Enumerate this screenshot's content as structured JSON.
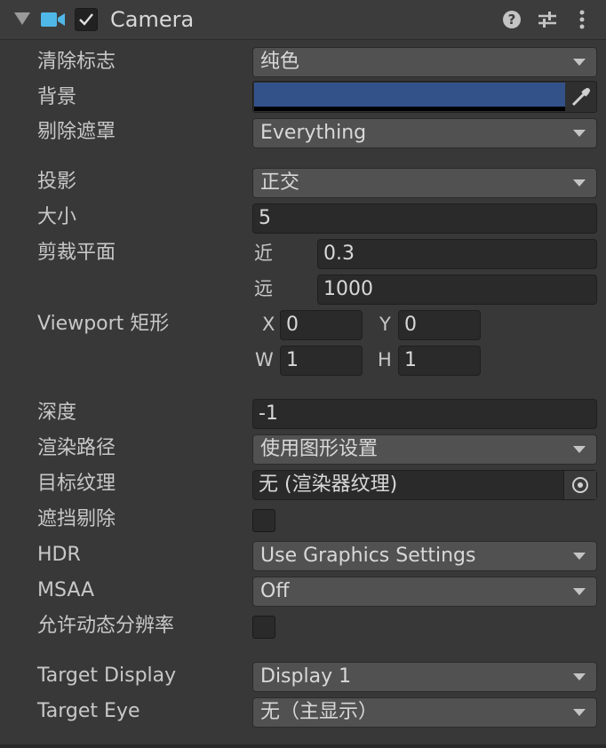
{
  "header": {
    "title": "Camera",
    "icons": [
      "foldout-arrow-icon",
      "camera-icon",
      "checkmark-icon",
      "help-icon",
      "preset-sliders-icon",
      "more-vertical-icon"
    ]
  },
  "fields": {
    "clear_flags": {
      "label": "清除标志",
      "value": "纯色"
    },
    "background": {
      "label": "背景",
      "color": "#34528a"
    },
    "culling_mask": {
      "label": "剔除遮罩",
      "value": "Everything"
    },
    "projection": {
      "label": "投影",
      "value": "正交"
    },
    "size": {
      "label": "大小",
      "value": "5"
    },
    "clipping": {
      "label": "剪裁平面",
      "near_label": "近",
      "near": "0.3",
      "far_label": "远",
      "far": "1000"
    },
    "viewport": {
      "label": "Viewport 矩形",
      "x_label": "X",
      "x": "0",
      "y_label": "Y",
      "y": "0",
      "w_label": "W",
      "w": "1",
      "h_label": "H",
      "h": "1"
    },
    "depth": {
      "label": "深度",
      "value": "-1"
    },
    "rendering_path": {
      "label": "渲染路径",
      "value": "使用图形设置"
    },
    "target_texture": {
      "label": "目标纹理",
      "value": "无 (渲染器纹理)"
    },
    "occlusion_culling": {
      "label": "遮挡剔除",
      "checked": false
    },
    "hdr": {
      "label": "HDR",
      "value": "Use Graphics Settings"
    },
    "msaa": {
      "label": "MSAA",
      "value": "Off"
    },
    "dynamic_resolution": {
      "label": "允许动态分辨率",
      "checked": false
    },
    "target_display": {
      "label": "Target Display",
      "value": "Display 1"
    },
    "target_eye": {
      "label": "Target Eye",
      "value": "无（主显示）"
    }
  }
}
